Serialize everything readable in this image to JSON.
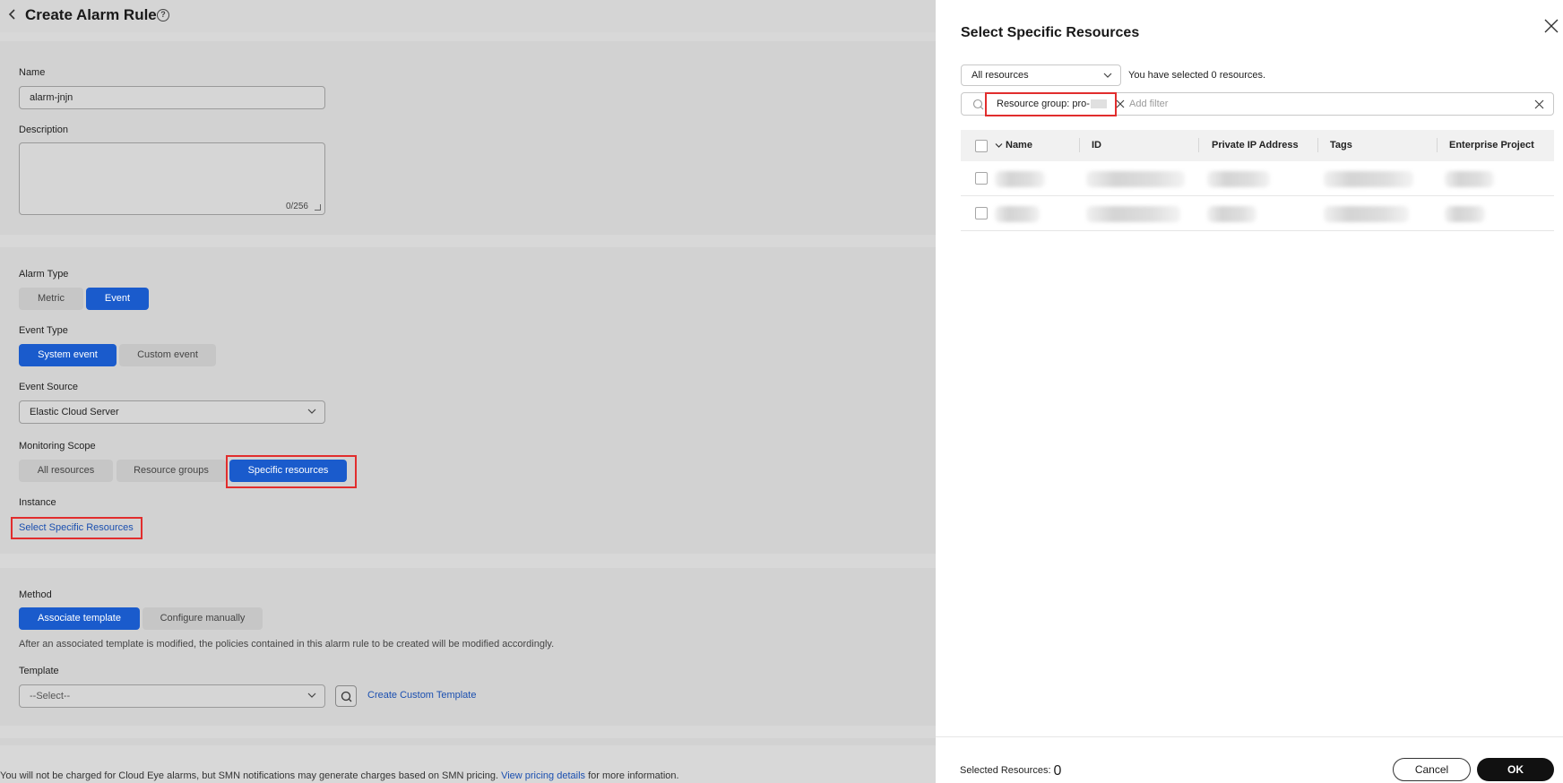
{
  "header": {
    "title": "Create Alarm Rule"
  },
  "basic": {
    "name_label": "Name",
    "name_value": "alarm-jnjn",
    "description_label": "Description",
    "description_counter": "0/256"
  },
  "alarm": {
    "alarm_type_label": "Alarm Type",
    "alarm_type_options": [
      "Metric",
      "Event"
    ],
    "alarm_type_selected": "Event",
    "event_type_label": "Event Type",
    "event_type_options": [
      "System event",
      "Custom event"
    ],
    "event_type_selected": "System event",
    "event_source_label": "Event Source",
    "event_source_value": "Elastic Cloud Server",
    "monitoring_scope_label": "Monitoring Scope",
    "monitoring_scope_options": [
      "All resources",
      "Resource groups",
      "Specific resources"
    ],
    "monitoring_scope_selected": "Specific resources",
    "instance_label": "Instance",
    "instance_link": "Select Specific Resources"
  },
  "method": {
    "method_label": "Method",
    "method_options": [
      "Associate template",
      "Configure manually"
    ],
    "method_selected": "Associate template",
    "method_hint": "After an associated template is modified, the policies contained in this alarm rule to be created will be modified accordingly.",
    "template_label": "Template",
    "template_placeholder": "--Select--",
    "create_template_link": "Create Custom Template"
  },
  "footer_note": {
    "before": "You will not be charged for Cloud Eye alarms, but SMN notifications may generate charges based on SMN pricing.",
    "link": "View pricing details",
    "after": "for more information."
  },
  "drawer": {
    "title": "Select Specific Resources",
    "scope_select": "All resources",
    "selected_text": "You have selected 0 resources.",
    "filter_chip": "Resource group: pro-",
    "filter_placeholder": "Add filter",
    "columns": [
      "Name",
      "ID",
      "Private IP Address",
      "Tags",
      "Enterprise Project"
    ],
    "rows_count_note": "",
    "selected_resources_label": "Selected Resources:",
    "selected_resources_count": "0",
    "cancel_label": "Cancel",
    "ok_label": "OK"
  },
  "colors": {
    "primary": "#1a5bcc",
    "highlight": "#e12d2d",
    "ok_button": "#111111"
  }
}
